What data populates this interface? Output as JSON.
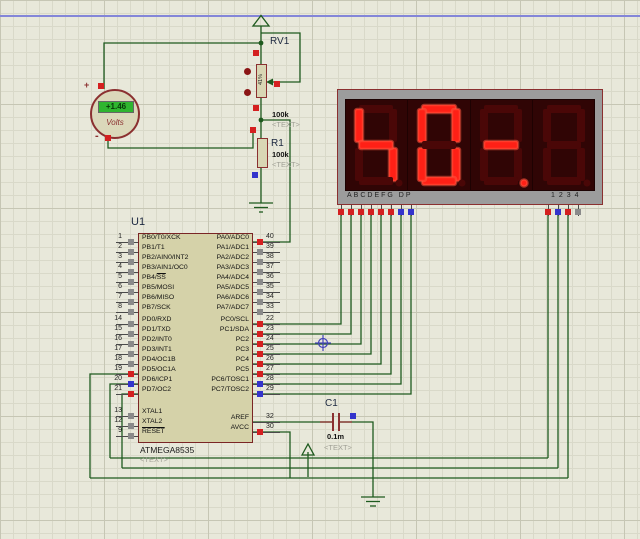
{
  "voltmeter": {
    "value": "+1.46",
    "unit": "Volts",
    "plus": "+",
    "minus": "-"
  },
  "rv1": {
    "ref": "RV1",
    "value": "100k",
    "placeholder": "<TEXT>",
    "wiper": "41%"
  },
  "r1": {
    "ref": "R1",
    "value": "100k",
    "placeholder": "<TEXT>"
  },
  "c1": {
    "ref": "C1",
    "value": "0.1m",
    "placeholder": "<TEXT>"
  },
  "chip": {
    "ref": "U1",
    "part": "ATMEGA8535",
    "placeholder": "<TEXT>",
    "left_pins": [
      {
        "num": "1",
        "label": "PB0/T0/XCK",
        "state": "gray"
      },
      {
        "num": "2",
        "label": "PB1/T1",
        "state": "gray"
      },
      {
        "num": "3",
        "label": "PB2/AIN0/INT2",
        "state": "gray"
      },
      {
        "num": "4",
        "label": "PB3/AIN1/OC0",
        "state": "gray"
      },
      {
        "num": "5",
        "label": "PB4/SS",
        "ol": "SS",
        "state": "gray"
      },
      {
        "num": "6",
        "label": "PB5/MOSI",
        "state": "gray"
      },
      {
        "num": "7",
        "label": "PB6/MISO",
        "state": "gray"
      },
      {
        "num": "8",
        "label": "PB7/SCK",
        "state": "gray"
      },
      {
        "num": "14",
        "label": "PD0/RXD",
        "state": "gray"
      },
      {
        "num": "15",
        "label": "PD1/TXD",
        "state": "gray"
      },
      {
        "num": "16",
        "label": "PD2/INT0",
        "state": "gray"
      },
      {
        "num": "17",
        "label": "PD3/INT1",
        "state": "gray"
      },
      {
        "num": "18",
        "label": "PD4/OC1B",
        "state": "gray"
      },
      {
        "num": "19",
        "label": "PD5/OC1A",
        "state": "red"
      },
      {
        "num": "20",
        "label": "PD6/ICP1",
        "state": "blue"
      },
      {
        "num": "21",
        "label": "PD7/OC2",
        "state": "red"
      },
      {
        "num": "13",
        "label": "XTAL1",
        "state": "gray"
      },
      {
        "num": "12",
        "label": "XTAL2",
        "state": "gray"
      },
      {
        "num": "9",
        "label": "RESET",
        "ol": "RESET",
        "state": "gray"
      }
    ],
    "right_pins": [
      {
        "num": "40",
        "label": "PA0/ADC0",
        "state": "red"
      },
      {
        "num": "39",
        "label": "PA1/ADC1",
        "state": "gray"
      },
      {
        "num": "38",
        "label": "PA2/ADC2",
        "state": "gray"
      },
      {
        "num": "37",
        "label": "PA3/ADC3",
        "state": "gray"
      },
      {
        "num": "36",
        "label": "PA4/ADC4",
        "state": "gray"
      },
      {
        "num": "35",
        "label": "PA5/ADC5",
        "state": "gray"
      },
      {
        "num": "34",
        "label": "PA6/ADC6",
        "state": "gray"
      },
      {
        "num": "33",
        "label": "PA7/ADC7",
        "state": "gray"
      },
      {
        "num": "22",
        "label": "PC0/SCL",
        "state": "red"
      },
      {
        "num": "23",
        "label": "PC1/SDA",
        "state": "red"
      },
      {
        "num": "24",
        "label": "PC2",
        "state": "red"
      },
      {
        "num": "25",
        "label": "PC3",
        "state": "red"
      },
      {
        "num": "26",
        "label": "PC4",
        "state": "red"
      },
      {
        "num": "27",
        "label": "PC5",
        "state": "red"
      },
      {
        "num": "28",
        "label": "PC6/TOSC1",
        "state": "blue"
      },
      {
        "num": "29",
        "label": "PC7/TOSC2",
        "state": "blue"
      },
      {
        "num": "32",
        "label": "AREF",
        "state": "none"
      },
      {
        "num": "30",
        "label": "AVCC",
        "state": "red"
      }
    ]
  },
  "display": {
    "segment_row_label": "ABCDEFG DP",
    "digit_row_label": "1234",
    "digits": [
      {
        "name": "digit-1",
        "lit": [
          "C",
          "F",
          "G"
        ],
        "dp": false
      },
      {
        "name": "digit-2",
        "lit": [
          "A",
          "B",
          "C",
          "D",
          "E",
          "F"
        ],
        "dp": false
      },
      {
        "name": "digit-3",
        "lit": [
          "G"
        ],
        "dp": true
      },
      {
        "name": "digit-4",
        "lit": [],
        "dp": false
      }
    ],
    "segment_pin_states": [
      "red",
      "red",
      "red",
      "red",
      "red",
      "red",
      "blue",
      "blue"
    ],
    "digit_pin_states": [
      "red",
      "blue",
      "red",
      "gray"
    ]
  },
  "colors": {
    "wire": "#1e5a1e",
    "component_outline": "#8b3030",
    "state_red": "#d42020",
    "state_blue": "#3434cc",
    "state_gray": "#8a8a8a",
    "seg_lit": "#ff2016",
    "seg_glow": "#ff5540",
    "seg_unlit": "#4a0707",
    "display_panel": "#300505",
    "display_frame": "#9c9c9c",
    "meter_screen": "#2fb52f",
    "sheet_border": "#8486d8",
    "marker_blue": "#4444bb"
  }
}
